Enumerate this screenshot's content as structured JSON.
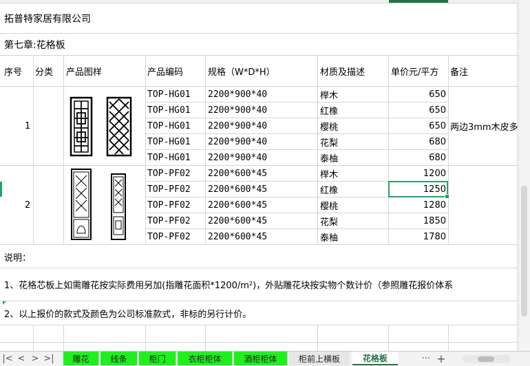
{
  "company": "拓普特家居有限公司",
  "chapter": "第七章:花格板",
  "headers": {
    "seq": "序号",
    "category": "分类",
    "image": "产品图样",
    "code": "产品编码",
    "spec": "规格（W*D*H）",
    "material": "材质及描述",
    "price": "单价元/平方",
    "note": "备注"
  },
  "groups": [
    {
      "seq": "1",
      "note": "两边3mm木皮多"
    },
    {
      "seq": "2",
      "note": ""
    }
  ],
  "rows": [
    {
      "code": "TOP-HG01",
      "spec": "2200*900*40",
      "material": "榉木",
      "price": "650"
    },
    {
      "code": "TOP-HG01",
      "spec": "2200*900*40",
      "material": "红橡",
      "price": "650"
    },
    {
      "code": "TOP-HG01",
      "spec": "2200*900*40",
      "material": "樱桃",
      "price": "650"
    },
    {
      "code": "TOP-HG01",
      "spec": "2200*900*40",
      "material": "花梨",
      "price": "680"
    },
    {
      "code": "TOP-HG01",
      "spec": "2200*900*40",
      "material": "泰柚",
      "price": "680"
    },
    {
      "code": "TOP-PF02",
      "spec": "2200*600*45",
      "material": "榉木",
      "price": "1200"
    },
    {
      "code": "TOP-PF02",
      "spec": "2200*600*45",
      "material": "红橡",
      "price": "1250"
    },
    {
      "code": "TOP-PF02",
      "spec": "2200*600*45",
      "material": "樱桃",
      "price": "1280"
    },
    {
      "code": "TOP-PF02",
      "spec": "2200*600*45",
      "material": "花梨",
      "price": "1850"
    },
    {
      "code": "TOP-PF02",
      "spec": "2200*600*45",
      "material": "泰柚",
      "price": "1780"
    }
  ],
  "notes": {
    "title": "说明：",
    "line1": "1、花格芯板上如需雕花按实际费用另加(指雕花面积*1200/m²)，外贴雕花块按实物个数计价（参照雕花报价体系",
    "line2": "2、以上报价的款式及颜色为公司标准款式，非标的另行计价。"
  },
  "sheet_tabs": [
    {
      "label": "雕花",
      "state": "green"
    },
    {
      "label": "线条",
      "state": "green"
    },
    {
      "label": "柜门",
      "state": "green"
    },
    {
      "label": "衣柜柜体",
      "state": "green"
    },
    {
      "label": "酒柜柜体",
      "state": "green"
    },
    {
      "label": "柜前上横板",
      "state": "plain"
    },
    {
      "label": "花格板",
      "state": "active"
    }
  ],
  "nav": {
    "first": "|<",
    "prev": "<",
    "next": ">",
    "last": ">|",
    "more": "···",
    "add": "+"
  },
  "colors": {
    "selection": "#21a366",
    "tab_green": "#1ef01e",
    "active_tab_text": "#217346"
  }
}
